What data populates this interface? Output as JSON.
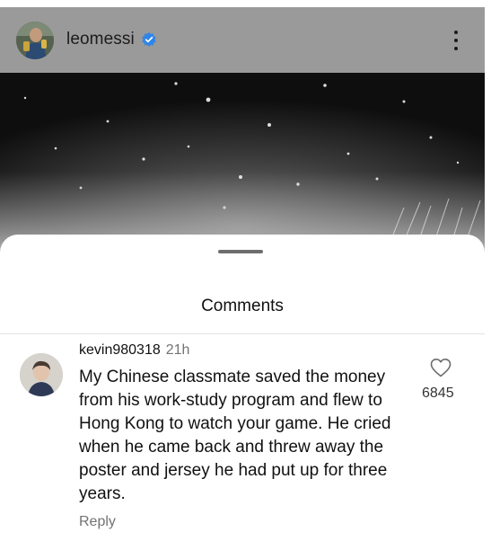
{
  "post": {
    "username": "leomessi",
    "verified_icon": "verified-badge-icon",
    "more_icon": "more-vertical-icon"
  },
  "sheet": {
    "title": "Comments"
  },
  "comment": {
    "username": "kevin980318",
    "time": "21h",
    "text": "My Chinese classmate saved the money from his work-study program and flew to Hong Kong to watch your game. He cried when he came back and threw away the poster and jersey he had put up for three years.",
    "likes": "6845",
    "reply_label": "Reply",
    "like_icon": "heart-outline-icon"
  },
  "colors": {
    "verified": "#2f86e8",
    "header_bg": "#9a9a9a",
    "muted_text": "#737373"
  }
}
